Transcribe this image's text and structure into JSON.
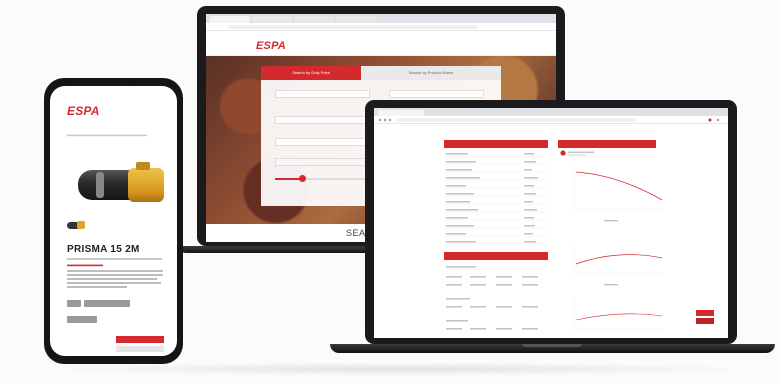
{
  "back_laptop": {
    "logo": "ESPA",
    "search_tabs": [
      {
        "label": "Search by Duty Point",
        "active": true
      },
      {
        "label": "Search by Product Name",
        "active": false
      }
    ],
    "bottom_heading": "SEARCH B"
  },
  "front_laptop": {
    "left_panel_title": "",
    "right_panel_title": "",
    "bottom_panel_title": ""
  },
  "phone": {
    "logo": "ESPA",
    "product_title": "PRISMA 15 2M"
  },
  "colors": {
    "brand_red": "#d42a2e",
    "device_black": "#1b1b1d"
  }
}
